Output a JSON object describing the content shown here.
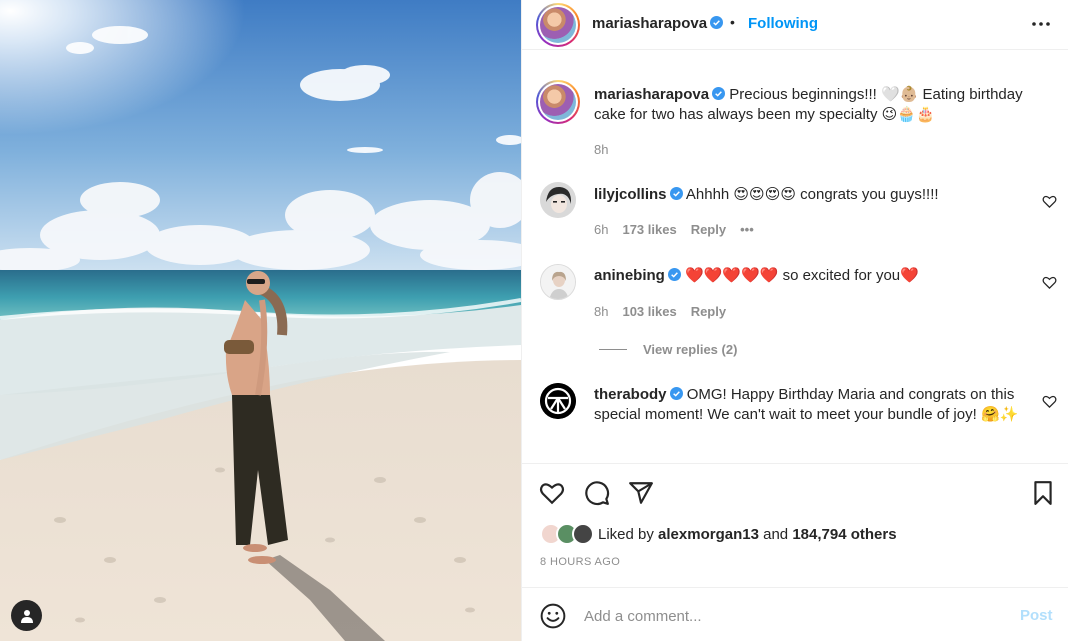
{
  "post": {
    "username": "mariasharapova",
    "follow_status": "Following",
    "separator": "•",
    "caption": "Precious beginnings!!! 🤍👶🏼 Eating birthday cake for two has always been my specialty 😉🧁🎂",
    "caption_time": "8h"
  },
  "comments": [
    {
      "username": "lilyjcollins",
      "text": "Ahhhh 😍😍😍😍 congrats you guys!!!!",
      "time": "6h",
      "likes": "173 likes",
      "reply": "Reply",
      "more": "•••"
    },
    {
      "username": "aninebing",
      "text": "❤️❤️❤️❤️❤️ so excited for you❤️",
      "time": "8h",
      "likes": "103 likes",
      "reply": "Reply",
      "view_replies": "View replies (2)"
    },
    {
      "username": "therabody",
      "text": "OMG! Happy Birthday Maria and congrats on this special moment! We can't wait to meet your bundle of joy! 🤗✨"
    }
  ],
  "likes": {
    "prefix": "Liked by",
    "user": "alexmorgan13",
    "conj": "and",
    "others": "184,794 others"
  },
  "timestamp": "8 HOURS AGO",
  "comment_box": {
    "placeholder": "Add a comment...",
    "post_label": "Post"
  },
  "icons": [
    "user-tag-icon",
    "verified-badge-icon",
    "more-options-icon",
    "heart-icon",
    "comment-icon",
    "share-icon",
    "bookmark-icon",
    "emoji-icon"
  ],
  "colors": {
    "link_blue": "#0095f6",
    "post_disabled": "#b2dffc",
    "muted_text": "#8e8e8e",
    "verified": "#3897f0"
  }
}
